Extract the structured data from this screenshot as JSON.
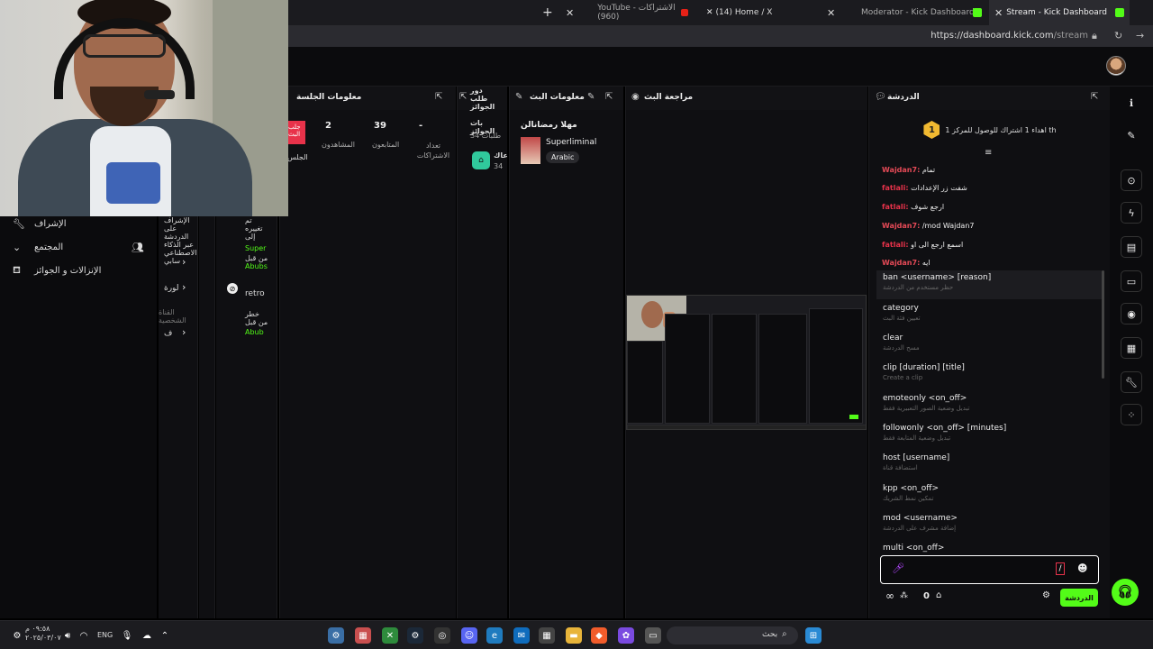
{
  "browser": {
    "tabs": [
      {
        "title": "YouTube - الاشتراكات (960)"
      },
      {
        "title": "(14) Home / X"
      },
      {
        "title": "Moderator - Kick Dashboard"
      },
      {
        "title": "Stream - Kick Dashboard"
      }
    ],
    "new_tab": "+",
    "close": "✕",
    "url_host": "https://dashboard.kick.com",
    "url_path": "/stream"
  },
  "sidebar": {
    "items": [
      {
        "label": "الإشراف"
      },
      {
        "label": "المجتمع"
      },
      {
        "label": "الإنزالات و الجوائز"
      }
    ]
  },
  "columns": {
    "col1": [
      "الإشراف",
      "على",
      "الدردشة",
      "عبر الذكاء",
      "الاصطناعي",
      "سابي"
    ],
    "col1_b": "لورة",
    "col1_c": "القناة الشخصية",
    "col1_d": "ف",
    "col3_top": [
      "تم",
      "تغييره",
      "إلى"
    ],
    "col3_green1": "Super",
    "col3_by": "من قبل",
    "col3_green2": "Abubs",
    "col3_retro": "retro",
    "col3_b": [
      "خطر",
      "من قبل"
    ],
    "col3_green3": "Abub"
  },
  "session_panel": {
    "title": "معلومات الجلسة",
    "live_badge": [
      "جلب",
      "البث"
    ],
    "session_label": "الجلس",
    "stats": [
      {
        "value": "2",
        "label": "المشاهدون"
      },
      {
        "value": "39",
        "label": "المتابعون"
      },
      {
        "value": "-",
        "label": "تعداد الاشتراكات"
      }
    ]
  },
  "rewards_panel": {
    "title": "دور طلب الجوائز",
    "subtitle": "بات الجوائز",
    "count": "طلبات 34",
    "item": "عاك",
    "item_count": "34"
  },
  "stream_info": {
    "title": "معلومات البث",
    "stream_title": "مهلا رمضانالن",
    "game": "Superliminal",
    "language": "Arabic"
  },
  "review": {
    "title": "مراجعة البث"
  },
  "chat": {
    "title": "الدردشة",
    "pinned_count": "1",
    "pinned_text": "اهداء 1 اشتراك للوصول للمركز 1 th",
    "messages": [
      {
        "user": "Wajdan7:",
        "text": "تمام",
        "color": "#e64a57"
      },
      {
        "user": "fatlali:",
        "text": "شفت زر الإعدادات",
        "color": "#e8324a"
      },
      {
        "user": "fatlali:",
        "text": "ارجع شوف",
        "color": "#e8324a"
      },
      {
        "user": "Wajdan7:",
        "text": "/mod Wajdan7",
        "color": "#e64a57"
      },
      {
        "user": "fatlali:",
        "text": "اسمع ارجع الى او",
        "color": "#e8324a"
      },
      {
        "user": "Wajdan7:",
        "text": "ايه",
        "color": "#e64a57"
      }
    ],
    "commands": [
      {
        "name": "ban <username> [reason]",
        "desc": "حظر مستخدم من الدردشة"
      },
      {
        "name": "category",
        "desc": "تعيين فئة البث"
      },
      {
        "name": "clear",
        "desc": "مسح الدردشة"
      },
      {
        "name": "clip [duration] [title]",
        "desc": "Create a clip"
      },
      {
        "name": "emoteonly <on_off>",
        "desc": "تبديل وضعية الصور التعبيرية فقط"
      },
      {
        "name": "followonly <on_off> [minutes]",
        "desc": "تبديل وضعية المتابعة فقط"
      },
      {
        "name": "host [username]",
        "desc": "استضافة قناة"
      },
      {
        "name": "kpp <on_off>",
        "desc": "تمكين نمط الشريك"
      },
      {
        "name": "mod <username>",
        "desc": "إضافة مشرف على الدردشة"
      },
      {
        "name": "multi <on_off>",
        "desc": ""
      }
    ],
    "input_value": "/",
    "send_label": "الدردشة",
    "footer_count": "0",
    "infinity": "∞"
  },
  "taskbar": {
    "time": "٠٩:٥٨ م",
    "date": "٢٠٢٥/٠٣/٠٧",
    "lang": "ENG",
    "search_placeholder": "بحث"
  },
  "colors": {
    "kick_green": "#53fc18",
    "live_red": "#e8324a",
    "pinned_gold": "#f1b931"
  }
}
